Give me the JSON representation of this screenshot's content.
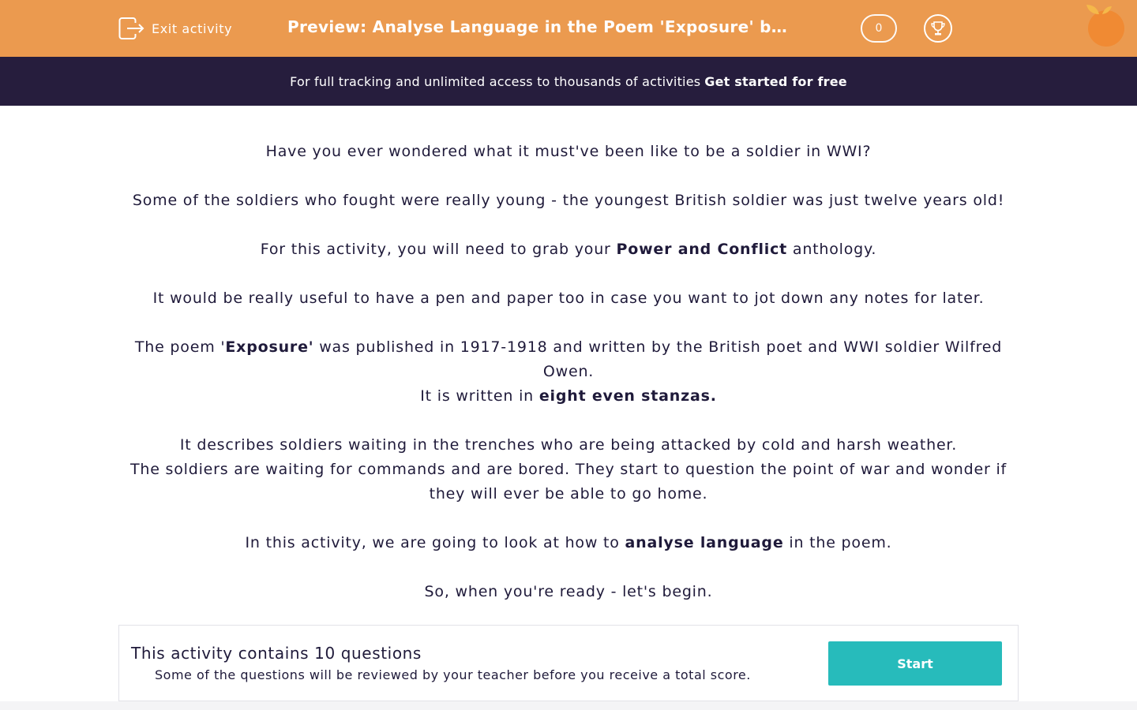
{
  "header": {
    "exit_label": "Exit activity",
    "title": "Preview: Analyse Language in the Poem 'Exposure' by Wilfred Owen",
    "score": "0",
    "icons": {
      "exit": "exit-icon",
      "trophy": "trophy-icon",
      "logo": "orange-logo"
    },
    "colors": {
      "header_bg": "#eb9a4f",
      "promo_bg": "#261d3d",
      "accent": "#27bbbb"
    }
  },
  "promo": {
    "text": "For full tracking and unlimited access to thousands of activities",
    "cta": "Get started for free"
  },
  "intro": {
    "p1": "Have you ever wondered what it must've been like to be a soldier in WWI?",
    "p2": "Some of the soldiers who fought were really young - the youngest British soldier was just twelve years old!",
    "p3_pre": "For this activity, you will need to grab your ",
    "p3_bold": "Power and Conflict",
    "p3_post": " anthology.",
    "p4": "It would be really useful to have a pen and paper too in case you want to jot down any notes for later.",
    "p5_pre": "The poem '",
    "p5_bold": "Exposure'",
    "p5_post": " was published in 1917-1918 and written by the British poet and WWI soldier Wilfred Owen.",
    "p6_pre": "It is written in ",
    "p6_bold": "eight even stanzas.",
    "p7": "It describes soldiers waiting in the trenches who are being attacked by cold and harsh weather.",
    "p8": "The soldiers are waiting for commands and are bored.  They start to question the point of war and wonder if they will ever be able to go home.",
    "p9_pre": "In this activity, we are going to look at how to ",
    "p9_bold": "analyse language",
    "p9_post": " in the poem.",
    "p10": "So, when you're ready - let's begin."
  },
  "footer": {
    "title": "This activity contains 10 questions",
    "subtitle": "Some of the questions will be reviewed by your teacher before you receive a total score.",
    "start_label": "Start"
  }
}
